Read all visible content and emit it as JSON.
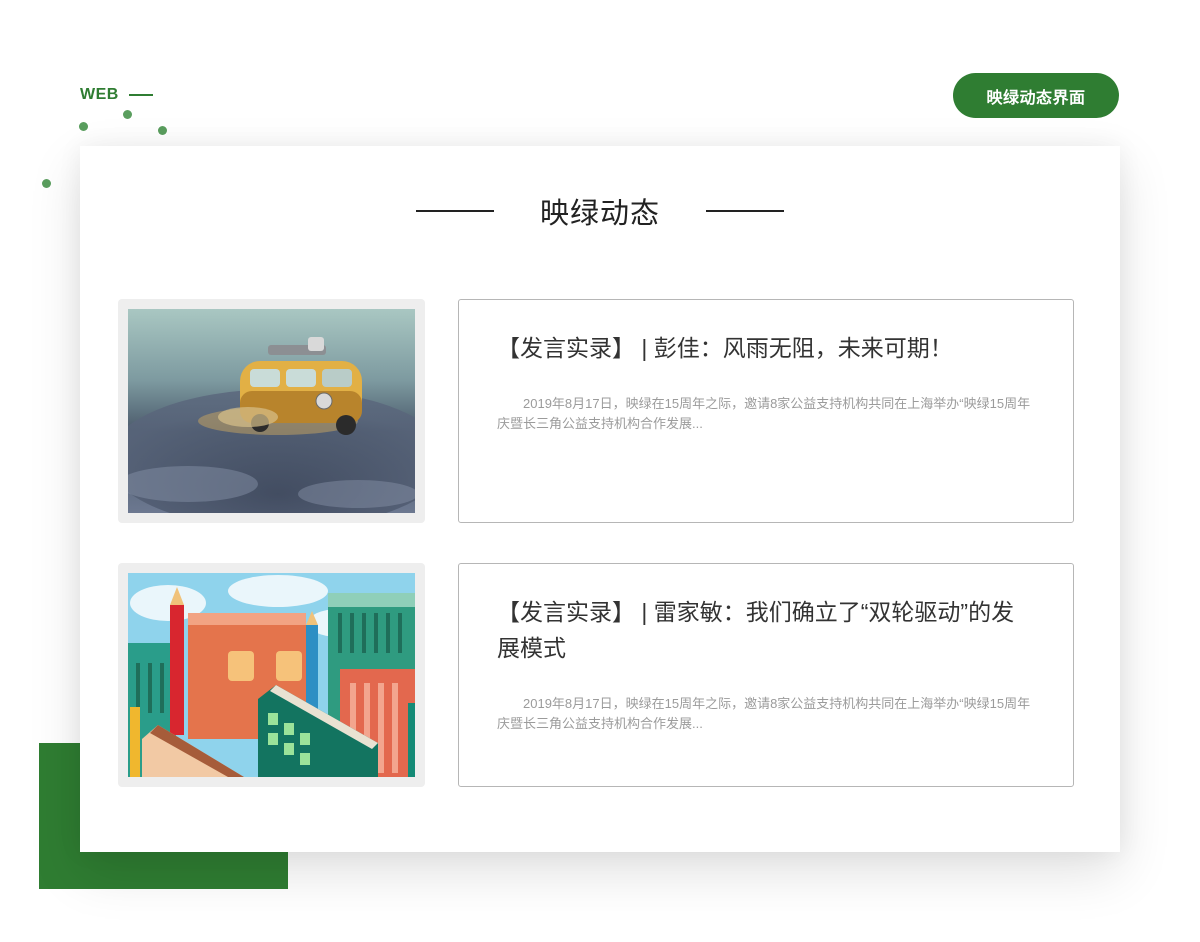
{
  "brand": {
    "web_label": "WEB"
  },
  "header": {
    "badge_label": "映绿动态界面"
  },
  "section": {
    "title": "映绿动态"
  },
  "news": [
    {
      "headline": "【发言实录】 | 彭佳：风雨无阻，未来可期！",
      "excerpt": "2019年8月17日，映绿在15周年之际，邀请8家公益支持机构共同在上海举办“映绿15周年庆暨长三角公益支持机构合作发展...",
      "image_icon": "toy-van-photo"
    },
    {
      "headline": "【发言实录】 | 雷家敏：我们确立了“双轮驱动”的发展模式",
      "excerpt": "2019年8月17日，映绿在15周年之际，邀请8家公益支持机构共同在上海举办“映绿15周年庆暨长三角公益支持机构合作发展...",
      "image_icon": "book-city-illustration"
    }
  ],
  "colors": {
    "accent": "#2f7d32",
    "dot": "#5a9e5e",
    "text": "#333333",
    "muted": "#9b9b9b"
  }
}
